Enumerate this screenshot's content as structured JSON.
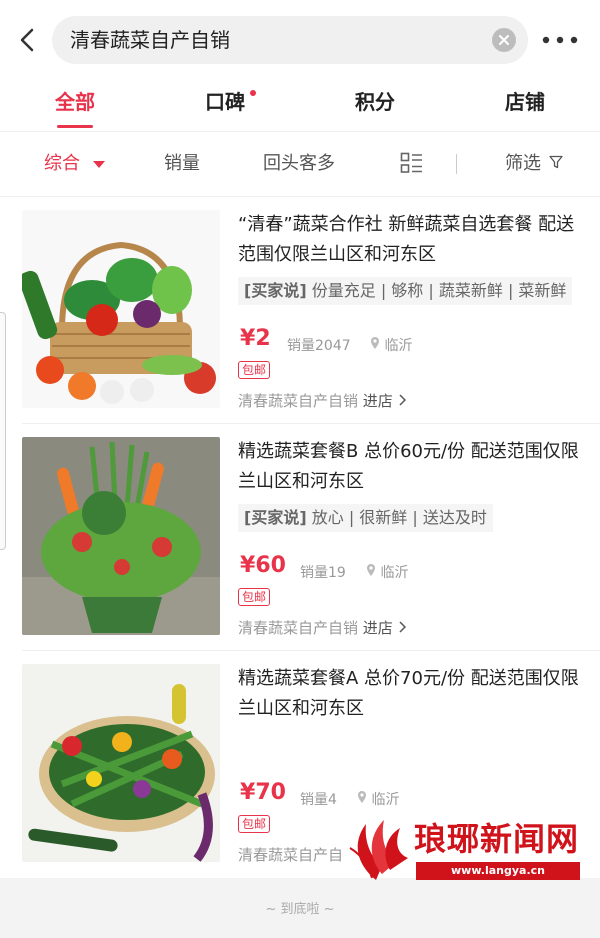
{
  "search": {
    "query": "清春蔬菜自产自销"
  },
  "tabs": [
    {
      "label": "全部",
      "active": true
    },
    {
      "label": "口碑",
      "dot": true
    },
    {
      "label": "积分"
    },
    {
      "label": "店铺"
    }
  ],
  "filters": {
    "comprehensive": "综合",
    "sales": "销量",
    "repeat": "回头客多",
    "filter": "筛选"
  },
  "products": [
    {
      "title": "“清春”蔬菜合作社 新鲜蔬菜自选套餐  配送范围仅限兰山区和河东区",
      "review_tag": "[买家说]",
      "review_text": "份量充足 | 够称 | 蔬菜新鲜 | 菜新鲜",
      "price": "2",
      "sales": "销量2047",
      "location": "临沂",
      "badge": "包邮",
      "shop": "清春蔬菜自产自销",
      "enter": "进店"
    },
    {
      "title": "精选蔬菜套餐B 总价60元/份  配送范围仅限兰山区和河东区",
      "review_tag": "[买家说]",
      "review_text": "放心 | 很新鲜 | 送达及时",
      "price": "60",
      "sales": "销量19",
      "location": "临沂",
      "badge": "包邮",
      "shop": "清春蔬菜自产自销",
      "enter": "进店"
    },
    {
      "title": "精选蔬菜套餐A 总价70元/份  配送范围仅限兰山区和河东区",
      "price": "70",
      "sales": "销量4",
      "location": "临沂",
      "badge": "包邮",
      "shop": "清春蔬菜自产自"
    }
  ],
  "currency": "¥",
  "footer": "~ 到底啦 ~",
  "watermark": {
    "brand": "琅琊新闻网",
    "url": "www.langya.cn"
  },
  "colors": {
    "accent": "#e8334a",
    "watermark": "#d0121b"
  }
}
